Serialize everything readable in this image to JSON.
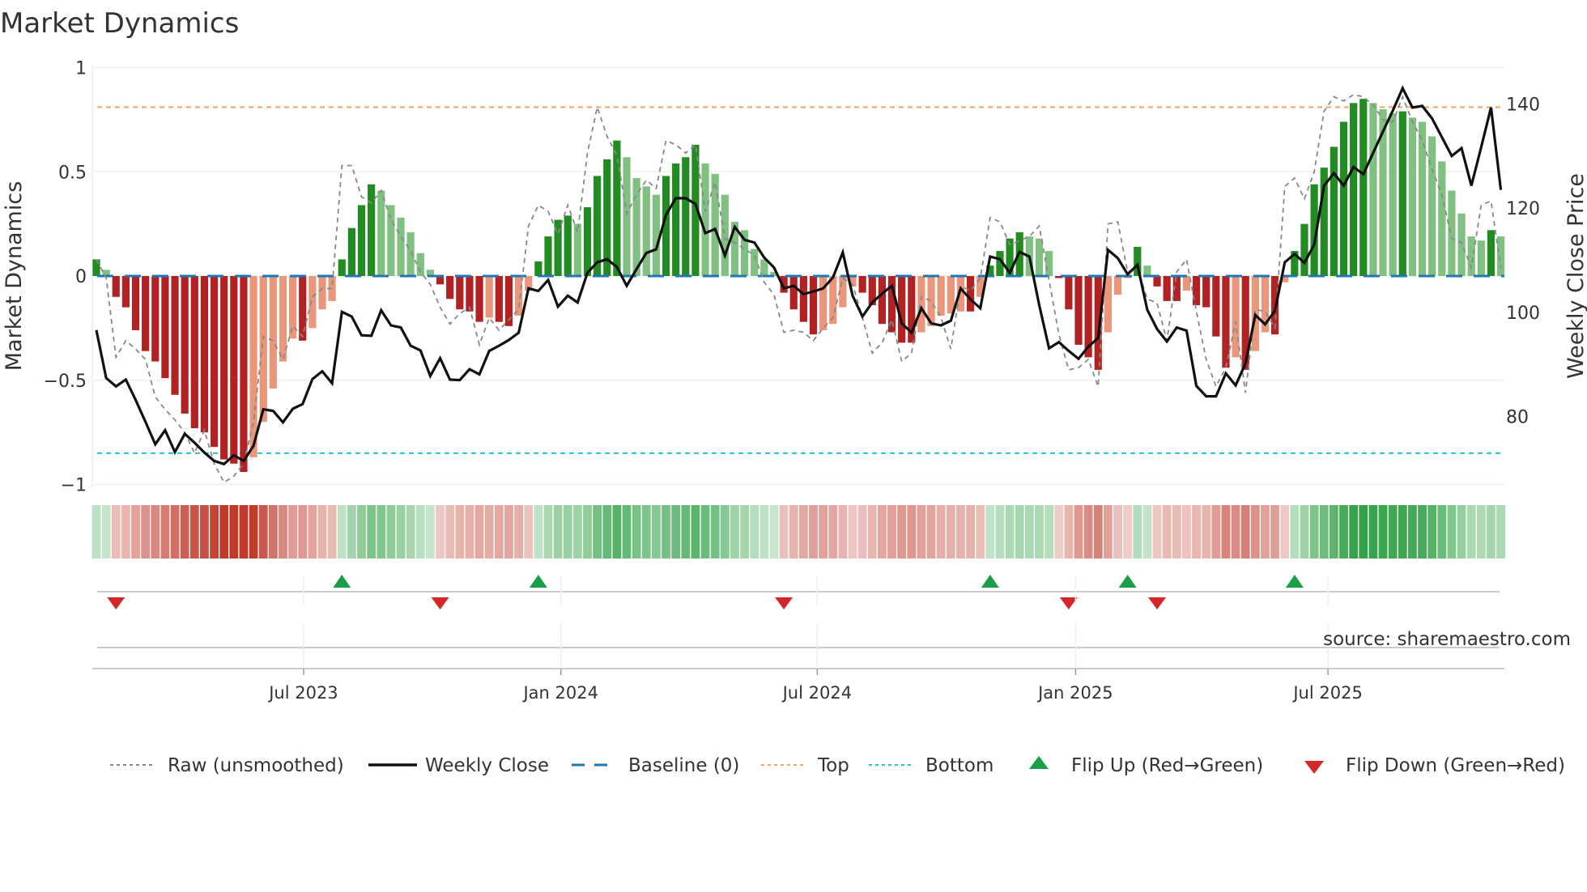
{
  "chart_data": {
    "type": "bar",
    "title": "Market Dynamics",
    "ylabel_left": "Market Dynamics",
    "ylabel_right": "Weekly Close Price",
    "ylim_left": [
      -1,
      1
    ],
    "ylim_right_ticks": [
      80,
      100,
      120,
      140
    ],
    "left_ticks": [
      {
        "v": 1,
        "label": "1"
      },
      {
        "v": 0.5,
        "label": "0.5"
      },
      {
        "v": 0,
        "label": "0"
      },
      {
        "v": -0.5,
        "label": "−0.5"
      },
      {
        "v": -1,
        "label": "−1"
      }
    ],
    "right_ticks": [
      {
        "v": 140,
        "label": "140"
      },
      {
        "v": 120,
        "label": "120"
      },
      {
        "v": 100,
        "label": "100"
      },
      {
        "v": 80,
        "label": "80"
      }
    ],
    "x_ticks": [
      {
        "label": "Jul 2023",
        "week": 21.1
      },
      {
        "label": "Jan 2024",
        "week": 47.3
      },
      {
        "label": "Jul 2024",
        "week": 73.4
      },
      {
        "label": "Jan 2025",
        "week": 99.7
      },
      {
        "label": "Jul 2025",
        "week": 125.4
      }
    ],
    "top_level": 0.81,
    "bottom_level": -0.85,
    "baseline": 0,
    "grid": true,
    "smoothed": [
      0.08,
      0.03,
      -0.1,
      -0.15,
      -0.26,
      -0.36,
      -0.41,
      -0.49,
      -0.57,
      -0.66,
      -0.73,
      -0.75,
      -0.82,
      -0.88,
      -0.9,
      -0.94,
      -0.87,
      -0.7,
      -0.54,
      -0.41,
      -0.3,
      -0.31,
      -0.25,
      -0.16,
      -0.12,
      0.08,
      0.23,
      0.34,
      0.44,
      0.41,
      0.34,
      0.28,
      0.21,
      0.11,
      0.03,
      -0.04,
      -0.11,
      -0.16,
      -0.17,
      -0.22,
      -0.2,
      -0.22,
      -0.24,
      -0.19,
      -0.07,
      0.07,
      0.19,
      0.27,
      0.29,
      0.25,
      0.33,
      0.48,
      0.56,
      0.65,
      0.57,
      0.47,
      0.43,
      0.39,
      0.48,
      0.54,
      0.57,
      0.63,
      0.54,
      0.49,
      0.39,
      0.26,
      0.22,
      0.13,
      0.08,
      0.02,
      -0.08,
      -0.16,
      -0.22,
      -0.28,
      -0.26,
      -0.23,
      -0.15,
      -0.05,
      -0.08,
      -0.14,
      -0.23,
      -0.27,
      -0.32,
      -0.32,
      -0.27,
      -0.24,
      -0.19,
      -0.18,
      -0.17,
      -0.17,
      -0.1,
      0.05,
      0.12,
      0.18,
      0.21,
      0.19,
      0.18,
      0.12,
      -0.01,
      -0.16,
      -0.33,
      -0.39,
      -0.45,
      -0.27,
      -0.09,
      -0.01,
      0.14,
      0.05,
      -0.05,
      -0.12,
      -0.12,
      -0.07,
      -0.14,
      -0.15,
      -0.29,
      -0.44,
      -0.39,
      -0.45,
      -0.36,
      -0.27,
      -0.28,
      -0.03,
      0.12,
      0.25,
      0.44,
      0.52,
      0.62,
      0.74,
      0.83,
      0.85,
      0.83,
      0.8,
      0.78,
      0.79,
      0.76,
      0.74,
      0.67,
      0.55,
      0.41,
      0.3,
      0.19,
      0.17,
      0.22,
      0.19
    ],
    "raw": [
      0.08,
      -0.01,
      -0.39,
      -0.31,
      -0.35,
      -0.4,
      -0.58,
      -0.64,
      -0.69,
      -0.75,
      -0.85,
      -0.74,
      -0.9,
      -0.99,
      -0.96,
      -0.9,
      -0.7,
      -0.29,
      -0.31,
      -0.4,
      -0.24,
      -0.29,
      -0.1,
      -0.06,
      -0.06,
      0.53,
      0.53,
      0.38,
      0.35,
      0.41,
      0.27,
      0.19,
      0.12,
      0.02,
      -0.04,
      -0.15,
      -0.23,
      -0.18,
      -0.15,
      -0.33,
      -0.2,
      -0.26,
      -0.21,
      -0.16,
      0.24,
      0.34,
      0.31,
      0.2,
      0.34,
      0.21,
      0.59,
      0.81,
      0.67,
      0.58,
      0.3,
      0.39,
      0.46,
      0.42,
      0.65,
      0.63,
      0.59,
      0.63,
      0.31,
      0.45,
      0.18,
      0.16,
      0.13,
      0.1,
      -0.03,
      -0.09,
      -0.27,
      -0.26,
      -0.27,
      -0.31,
      -0.25,
      -0.2,
      -0.01,
      -0.04,
      -0.2,
      -0.37,
      -0.32,
      -0.21,
      -0.41,
      -0.37,
      -0.1,
      -0.12,
      -0.2,
      -0.35,
      -0.05,
      -0.07,
      -0.01,
      0.28,
      0.26,
      0.15,
      0.17,
      0.19,
      0.24,
      -0.02,
      -0.28,
      -0.45,
      -0.44,
      -0.4,
      -0.53,
      0.25,
      0.26,
      0.02,
      0.04,
      -0.11,
      -0.13,
      -0.31,
      0.02,
      0.08,
      -0.17,
      -0.4,
      -0.53,
      -0.44,
      -0.22,
      -0.56,
      -0.16,
      -0.17,
      -0.25,
      0.43,
      0.47,
      0.37,
      0.5,
      0.79,
      0.86,
      0.84,
      0.87,
      0.86,
      0.82,
      0.75,
      0.74,
      0.86,
      0.74,
      0.65,
      0.51,
      0.39,
      0.18,
      0.16,
      0.04,
      0.34,
      0.36,
      0.04
    ],
    "weekly_close": [
      96.6,
      87.4,
      85.8,
      87.1,
      83.2,
      79.0,
      74.7,
      77.4,
      73.2,
      76.7,
      75.0,
      73.1,
      71.5,
      70.9,
      72.6,
      71.5,
      74.4,
      81.4,
      81.1,
      78.9,
      81.5,
      82.4,
      87.2,
      88.7,
      86.4,
      100.1,
      99.2,
      95.6,
      95.5,
      100.4,
      97.5,
      97.1,
      93.6,
      92.7,
      87.8,
      91.2,
      87.1,
      87.0,
      89.1,
      88.1,
      92.6,
      93.6,
      94.7,
      96.1,
      104.6,
      104.1,
      106.2,
      101.1,
      103.2,
      101.9,
      107.6,
      109.6,
      110.2,
      108.7,
      105.1,
      108.3,
      111.4,
      112.1,
      118.7,
      121.9,
      121.9,
      120.8,
      115.2,
      116.0,
      110.9,
      116.4,
      113.9,
      113.4,
      110.5,
      108.6,
      104.6,
      105.1,
      103.5,
      104.0,
      104.6,
      106.7,
      111.5,
      103.2,
      99.2,
      101.9,
      103.6,
      105.1,
      97.9,
      96.1,
      100.8,
      97.9,
      97.5,
      98.4,
      104.6,
      102.5,
      100.8,
      110.7,
      110.2,
      107.6,
      111.6,
      110.7,
      101.4,
      93.1,
      94.3,
      92.6,
      91.1,
      93.4,
      95.1,
      112.0,
      110.4,
      107.3,
      109.1,
      100.5,
      96.8,
      94.4,
      97.1,
      96.5,
      85.9,
      83.9,
      83.9,
      88.3,
      86.0,
      90.2,
      99.5,
      97.7,
      100.3,
      109.6,
      111.2,
      109.5,
      113.0,
      124.3,
      126.7,
      124.3,
      127.9,
      126.5,
      130.6,
      134.7,
      138.7,
      143.0,
      139.3,
      139.6,
      137.2,
      133.6,
      130.0,
      131.5,
      124.3,
      131.7,
      139.3,
      123.5
    ],
    "flip_up_weeks": [
      25,
      45,
      91,
      105,
      122
    ],
    "flip_down_weeks": [
      2,
      35,
      70,
      99,
      108
    ],
    "legend": [
      {
        "key": "raw",
        "label": "Raw (unsmoothed)"
      },
      {
        "key": "close",
        "label": "Weekly Close"
      },
      {
        "key": "baseline",
        "label": "Baseline (0)"
      },
      {
        "key": "top",
        "label": "Top"
      },
      {
        "key": "bottom",
        "label": "Bottom"
      },
      {
        "key": "flipup",
        "label": "Flip Up (Red→Green)"
      },
      {
        "key": "flipdown",
        "label": "Flip Down (Green→Red)"
      }
    ],
    "legend_position": "bottom",
    "source": "source: sharemaestro.com"
  },
  "colors": {
    "green_strong": "#228b22",
    "green_weak": "#80c080",
    "red_strong": "#b22222",
    "red_weak": "#e9967a",
    "baseline": "#1f77b4",
    "top": "#f4a460",
    "bottom": "#20c5d5",
    "raw": "#888888",
    "close": "#111111",
    "flip_up": "#1a9e48",
    "flip_down": "#d62728"
  }
}
